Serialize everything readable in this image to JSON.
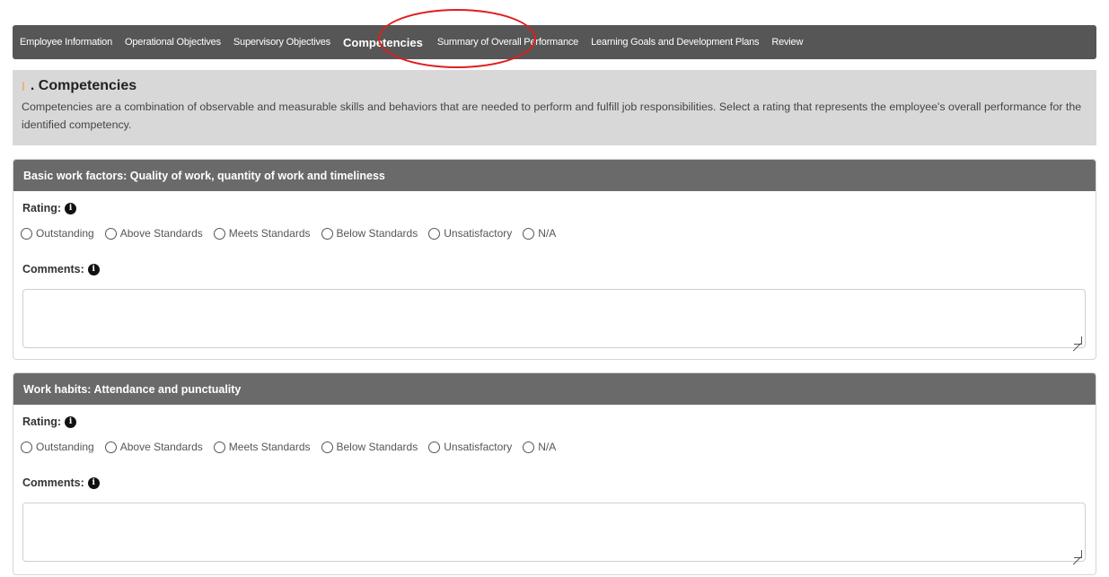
{
  "nav": {
    "items": [
      {
        "label": "Employee Information"
      },
      {
        "label": "Operational Objectives"
      },
      {
        "label": "Supervisory Objectives"
      },
      {
        "label": "Competencies",
        "active": true
      },
      {
        "label": "Summary of Overall Performance"
      },
      {
        "label": "Learning Goals and Development Plans"
      },
      {
        "label": "Review"
      }
    ]
  },
  "intro": {
    "marker": "I",
    "title": ". Competencies",
    "description": "Competencies are a combination of observable and measurable skills and behaviors that are needed to perform and fulfill job responsibilities. Select a rating that represents the employee's overall performance for the identified competency."
  },
  "sections": [
    {
      "title": "Basic work factors: Quality of work, quantity of work and timeliness",
      "rating_label": "Rating:",
      "comments_label": "Comments:",
      "options": [
        "Outstanding",
        "Above Standards",
        "Meets Standards",
        "Below Standards",
        "Unsatisfactory",
        "N/A"
      ],
      "comment_value": ""
    },
    {
      "title": "Work habits: Attendance and punctuality",
      "rating_label": "Rating:",
      "comments_label": "Comments:",
      "options": [
        "Outstanding",
        "Above Standards",
        "Meets Standards",
        "Below Standards",
        "Unsatisfactory",
        "N/A"
      ],
      "comment_value": ""
    }
  ],
  "icons": {
    "info": "info-icon",
    "info_glyph": "i"
  },
  "colors": {
    "nav_bg": "#565656",
    "section_header_bg": "#6a6a6a",
    "intro_bg": "#d8d8d8",
    "highlight": "#e01e1e"
  }
}
